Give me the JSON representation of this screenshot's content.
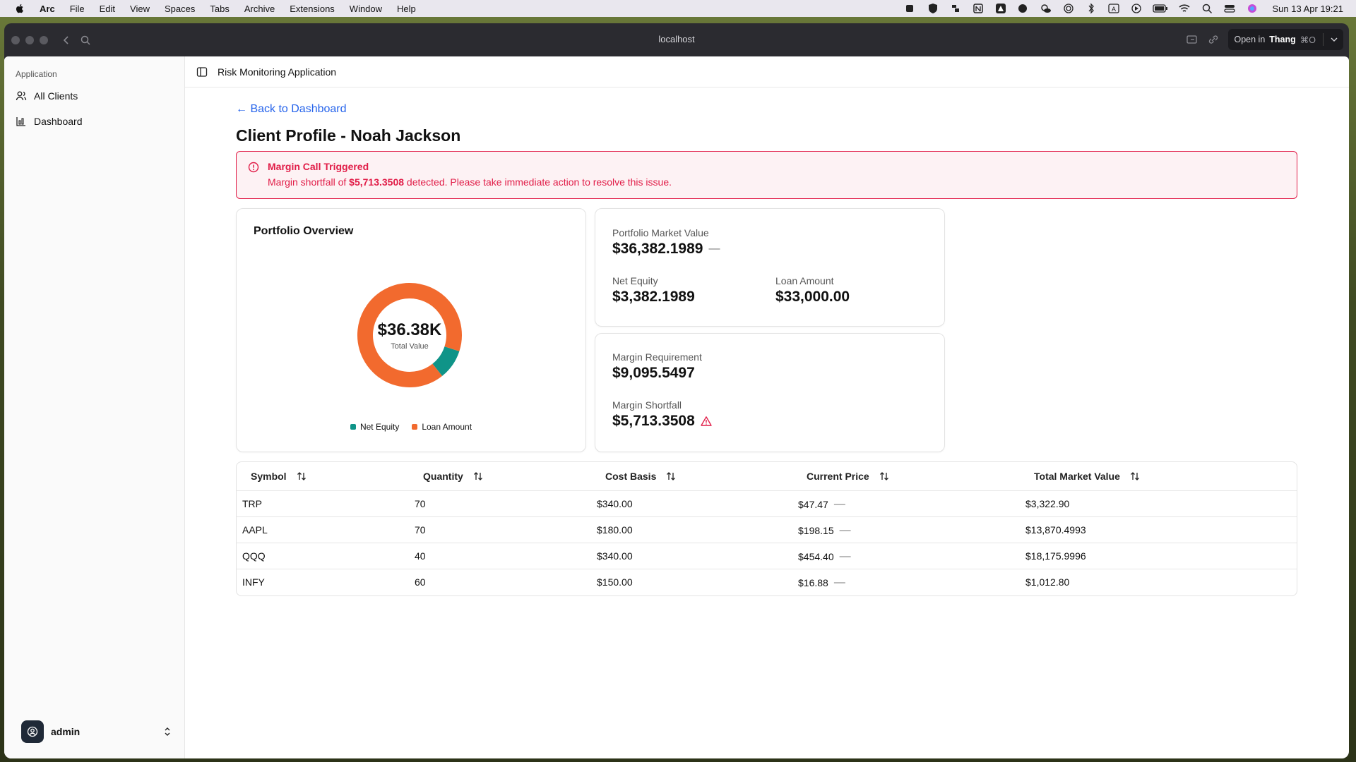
{
  "menubar": {
    "app_name": "Arc",
    "items": [
      "File",
      "Edit",
      "View",
      "Spaces",
      "Tabs",
      "Archive",
      "Extensions",
      "Window",
      "Help"
    ],
    "clock": "Sun 13 Apr  19:21"
  },
  "browser": {
    "url": "localhost",
    "open_in_prefix": "Open in",
    "open_in_app": "Thang",
    "open_in_shortcut": "⌘O"
  },
  "sidebar": {
    "group_label": "Application",
    "items": [
      {
        "label": "All Clients",
        "icon": "users-icon"
      },
      {
        "label": "Dashboard",
        "icon": "chart-icon"
      }
    ],
    "user": "admin"
  },
  "header": {
    "title": "Risk Monitoring Application"
  },
  "page": {
    "back_label": "← Back to Dashboard",
    "title": "Client Profile - Noah Jackson"
  },
  "alert": {
    "title": "Margin Call Triggered",
    "msg_prefix": "Margin shortfall of ",
    "amount": "$5,713.3508",
    "msg_suffix": " detected. Please take immediate action to resolve this issue.",
    "color": "#e11d48"
  },
  "overview": {
    "title": "Portfolio Overview",
    "center_value": "$36.38K",
    "center_label": "Total Value",
    "legend": [
      {
        "label": "Net Equity",
        "color": "#0f9488"
      },
      {
        "label": "Loan Amount",
        "color": "#f26a2e"
      }
    ]
  },
  "chart_data": {
    "type": "pie",
    "categories": [
      "Net Equity",
      "Loan Amount"
    ],
    "values": [
      3382.1989,
      33000.0
    ],
    "colors": [
      "#0f9488",
      "#f26a2e"
    ],
    "donut": true
  },
  "metrics": {
    "market_value_label": "Portfolio Market Value",
    "market_value": "$36,382.1989",
    "net_equity_label": "Net Equity",
    "net_equity": "$3,382.1989",
    "loan_label": "Loan Amount",
    "loan": "$33,000.00",
    "margin_req_label": "Margin Requirement",
    "margin_req": "$9,095.5497",
    "shortfall_label": "Margin Shortfall",
    "shortfall": "$5,713.3508",
    "dash": "—"
  },
  "table": {
    "headers": [
      "Symbol",
      "Quantity",
      "Cost Basis",
      "Current Price",
      "Total Market Value"
    ],
    "rows": [
      {
        "symbol": "TRP",
        "qty": "70",
        "cost": "$340.00",
        "price": "$47.47",
        "total": "$3,322.90"
      },
      {
        "symbol": "AAPL",
        "qty": "70",
        "cost": "$180.00",
        "price": "$198.15",
        "total": "$13,870.4993"
      },
      {
        "symbol": "QQQ",
        "qty": "40",
        "cost": "$340.00",
        "price": "$454.40",
        "total": "$18,175.9996"
      },
      {
        "symbol": "INFY",
        "qty": "60",
        "cost": "$150.00",
        "price": "$16.88",
        "total": "$1,012.80"
      }
    ]
  }
}
